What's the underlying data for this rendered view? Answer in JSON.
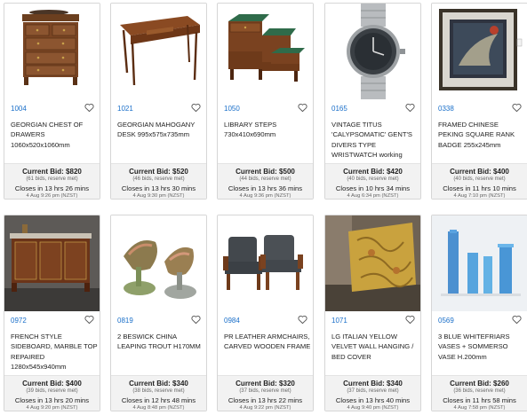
{
  "lots": [
    {
      "lot": "1004",
      "title": "GEORGIAN CHEST OF DRAWERS 1060x520x1060mm",
      "bid": "Current Bid: $820",
      "bids": "(61 bids, reserve met)",
      "closes": "Closes in 13 hrs 26 mins",
      "date": "4 Aug 9:26 pm (NZST)",
      "image": "chest-of-drawers"
    },
    {
      "lot": "1021",
      "title": "GEORGIAN MAHOGANY DESK 995x575x735mm",
      "bid": "Current Bid: $520",
      "bids": "(46 bids, reserve met)",
      "closes": "Closes in 13 hrs 30 mins",
      "date": "4 Aug 9:30 pm (NZST)",
      "image": "desk"
    },
    {
      "lot": "1050",
      "title": "LIBRARY STEPS 730x410x690mm",
      "bid": "Current Bid: $500",
      "bids": "(44 bids, reserve met)",
      "closes": "Closes in 13 hrs 36 mins",
      "date": "4 Aug 9:36 pm (NZST)",
      "image": "library-steps"
    },
    {
      "lot": "0165",
      "title": "VINTAGE TITUS 'CALYPSOMATIC' GENT'S DIVERS TYPE WRISTWATCH working",
      "bid": "Current Bid: $420",
      "bids": "(40 bids, reserve met)",
      "closes": "Closes in 10 hrs 34 mins",
      "date": "4 Aug 6:34 pm (NZST)",
      "image": "wristwatch"
    },
    {
      "lot": "0338",
      "title": "FRAMED CHINESE PEKING SQUARE RANK BADGE 255x245mm",
      "bid": "Current Bid: $400",
      "bids": "(40 bids, reserve met)",
      "closes": "Closes in 11 hrs 10 mins",
      "date": "4 Aug 7:10 pm (NZST)",
      "image": "framed-badge"
    },
    {
      "lot": "0972",
      "title": "FRENCH STYLE SIDEBOARD, MARBLE TOP REPAIRED 1280x545x940mm",
      "bid": "Current Bid: $400",
      "bids": "(39 bids, reserve met)",
      "closes": "Closes in 13 hrs 20 mins",
      "date": "4 Aug 9:20 pm (NZST)",
      "image": "sideboard"
    },
    {
      "lot": "0819",
      "title": "2 BESWICK CHINA LEAPING TROUT H170MM",
      "bid": "Current Bid: $340",
      "bids": "(38 bids, reserve met)",
      "closes": "Closes in 12 hrs 48 mins",
      "date": "4 Aug 8:48 pm (NZST)",
      "image": "trout-figures"
    },
    {
      "lot": "0984",
      "title": "PR LEATHER ARMCHAIRS, CARVED WOODEN FRAME",
      "bid": "Current Bid: $320",
      "bids": "(37 bids, reserve met)",
      "closes": "Closes in 13 hrs 22 mins",
      "date": "4 Aug 9:22 pm (NZST)",
      "image": "armchairs"
    },
    {
      "lot": "1071",
      "title": "LG ITALIAN YELLOW VELVET WALL HANGING / BED COVER",
      "bid": "Current Bid: $340",
      "bids": "(37 bids, reserve met)",
      "closes": "Closes in 13 hrs 40 mins",
      "date": "4 Aug 9:40 pm (NZST)",
      "image": "wall-hanging"
    },
    {
      "lot": "0569",
      "title": "3 BLUE WHITEFRIARS VASES + SOMMERSO VASE H.200mm",
      "bid": "Current Bid: $260",
      "bids": "(36 bids, reserve met)",
      "closes": "Closes in 11 hrs 58 mins",
      "date": "4 Aug 7:58 pm (NZST)",
      "image": "blue-vases"
    }
  ],
  "colors": {
    "lot_link": "#1a6fc9",
    "bid_panel": "#f2f2f2",
    "border": "#d6d6d6"
  },
  "icons": {
    "favourite": "heart-outline-icon"
  }
}
